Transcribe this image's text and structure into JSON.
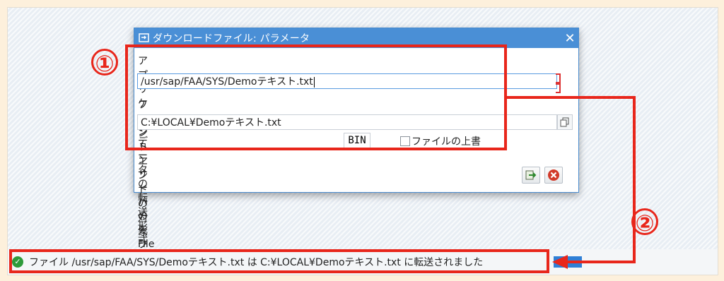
{
  "dialog": {
    "title": "ダウンロードファイル: パラメータ",
    "app_server_label": "アプリケーションサーバの元ファイル",
    "app_server_path": "/usr/sap/FAA/SYS/Demoテキスト.txt",
    "frontend_label": "フロントエンドの対象File",
    "frontend_path": "C:¥LOCAL¥Demoテキスト.txt",
    "transfer_format_label": "データの転送形式",
    "transfer_format_value": "BIN",
    "overwrite_label": "ファイルの上書"
  },
  "status": {
    "message": "ファイル /usr/sap/FAA/SYS/Demoテキスト.txt は C:¥LOCAL¥Demoテキスト.txt に転送されました",
    "type": "success"
  },
  "annotations": {
    "marker1": "①",
    "marker2": "②",
    "color": "#e8261b"
  },
  "colors": {
    "titlebar": "#4a8fd6",
    "success": "#2e9a3a"
  }
}
